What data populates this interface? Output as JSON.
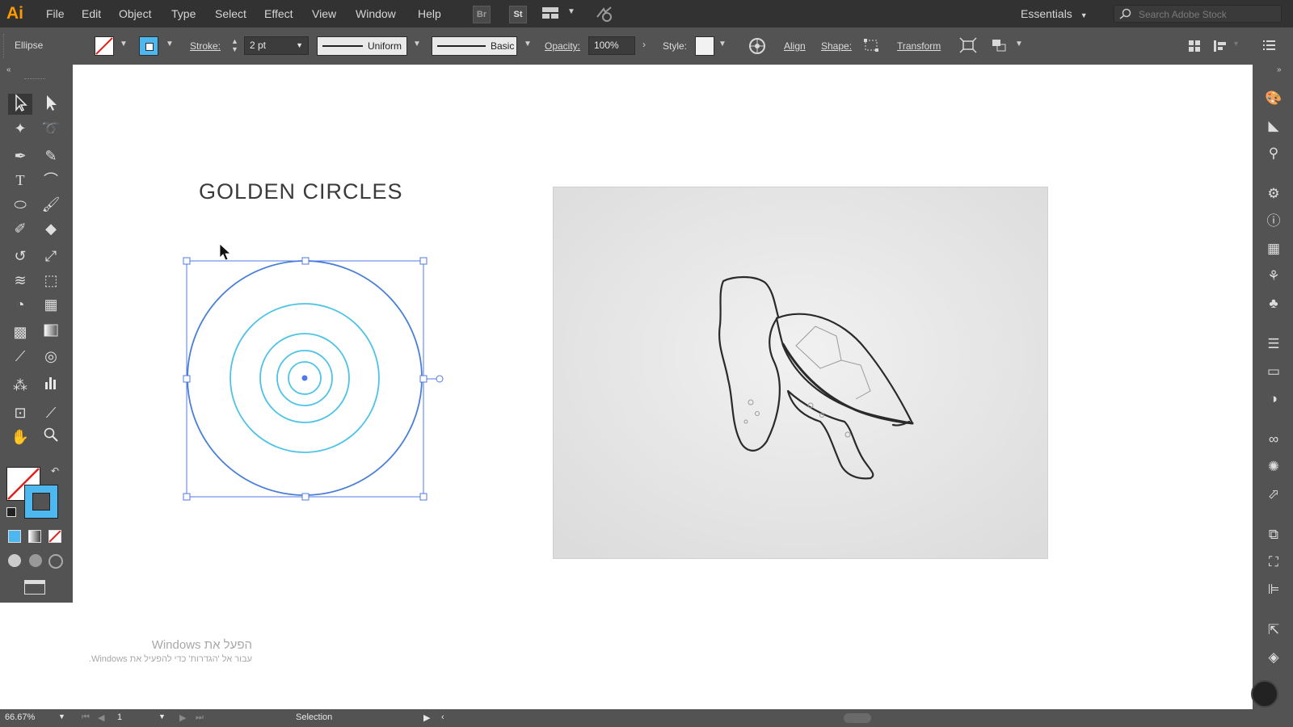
{
  "menubar": {
    "logo": "Ai",
    "items": [
      "File",
      "Edit",
      "Object",
      "Type",
      "Select",
      "Effect",
      "View",
      "Window",
      "Help"
    ],
    "bridge_label": "Br",
    "stock_label": "St",
    "workspace": "Essentials",
    "search_placeholder": "Search Adobe Stock"
  },
  "control_bar": {
    "object_type": "Ellipse",
    "stroke_label": "Stroke:",
    "stroke_weight": "2 pt",
    "profile": "Uniform",
    "brush": "Basic",
    "opacity_label": "Opacity:",
    "opacity_value": "100%",
    "style_label": "Style:",
    "align_label": "Align",
    "shape_label": "Shape:",
    "transform_label": "Transform",
    "fill_color": "none",
    "stroke_color": "#4db8f0"
  },
  "artboard": {
    "title": "GOLDEN CIRCLES",
    "circle_stroke_color": "#4fc3e6",
    "selection_color": "#5078e6"
  },
  "status_bar": {
    "zoom": "66.67%",
    "artboard_number": "1",
    "tool": "Selection"
  },
  "watermark": {
    "line1": "הפעל את Windows",
    "line2": "עבור אל 'הגדרות' כדי להפעיל את Windows."
  },
  "tools": [
    "selection-tool",
    "direct-selection-tool",
    "magic-wand-tool",
    "lasso-tool",
    "pen-tool",
    "curvature-tool",
    "type-tool",
    "arc-tool",
    "ellipse-tool",
    "paintbrush-tool",
    "shaper-tool",
    "eraser-tool",
    "rotate-tool",
    "scale-tool",
    "width-tool",
    "free-transform-tool",
    "shape-builder-tool",
    "perspective-grid-tool",
    "mesh-tool",
    "gradient-tool",
    "eyedropper-tool",
    "blend-tool",
    "symbol-sprayer-tool",
    "column-graph-tool",
    "artboard-tool",
    "slice-tool",
    "hand-tool",
    "zoom-tool"
  ]
}
